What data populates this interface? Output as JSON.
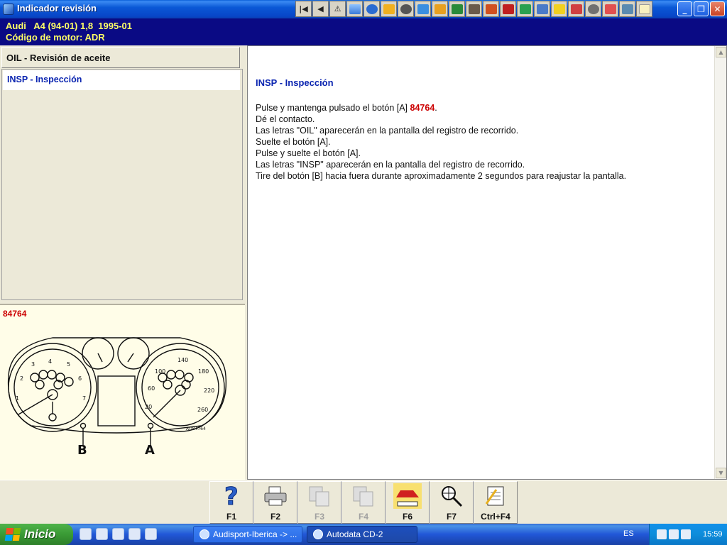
{
  "window": {
    "title": "Indicador revisión",
    "toolbar_icons": [
      "first-page-icon",
      "previous-icon",
      "warning-icon",
      "chart-icon",
      "gear-icon",
      "wrench-icon",
      "wheel-icon",
      "tool-icon",
      "oil-can-icon",
      "lift-icon",
      "engine-icon",
      "spark-plug-icon",
      "battery-icon",
      "car-icon",
      "belt-icon",
      "bulb-icon",
      "service-icon",
      "clock-icon",
      "tire-icon",
      "brake-icon",
      "info-icon"
    ]
  },
  "vehicle": {
    "line1": "Audi   A4 (94-01) 1,8  1995-01",
    "line2": "Código de motor: ADR"
  },
  "sidebar": {
    "oil_label": "OIL - Revisión de aceite",
    "insp_label": "INSP - Inspección"
  },
  "image": {
    "code": "84764",
    "ref": "AD84764",
    "label_a": "A",
    "label_b": "B"
  },
  "content": {
    "heading": "INSP - Inspección",
    "line1_before": "Pulse y mantenga pulsado el botón [A] ",
    "line1_code": "84764",
    "line1_after": ".",
    "lines": [
      "Dé el contacto.",
      "Las letras \"OIL\" aparecerán en la pantalla del registro de recorrido.",
      "Suelte el botón [A].",
      "Pulse y suelte el botón [A].",
      "Las letras \"INSP\" aparecerán en la pantalla del registro de recorrido.",
      "Tire del botón [B] hacia fuera durante aproximadamente 2 segundos para reajustar la pantalla."
    ]
  },
  "fkeys": [
    {
      "label": "F1",
      "icon": "help-icon",
      "enabled": true
    },
    {
      "label": "F2",
      "icon": "printer-icon",
      "enabled": true
    },
    {
      "label": "F3",
      "icon": "copy-icon",
      "enabled": false
    },
    {
      "label": "F4",
      "icon": "paste-icon",
      "enabled": false
    },
    {
      "label": "F6",
      "icon": "car-service-icon",
      "enabled": true
    },
    {
      "label": "F7",
      "icon": "magnifier-icon",
      "enabled": true
    },
    {
      "label": "Ctrl+F4",
      "icon": "notes-icon",
      "enabled": true
    }
  ],
  "taskbar": {
    "start_label": "Inicio",
    "task1": "Audisport-Iberica -> ...",
    "task2": "Autodata CD-2",
    "language": "ES",
    "clock": "15:59"
  }
}
